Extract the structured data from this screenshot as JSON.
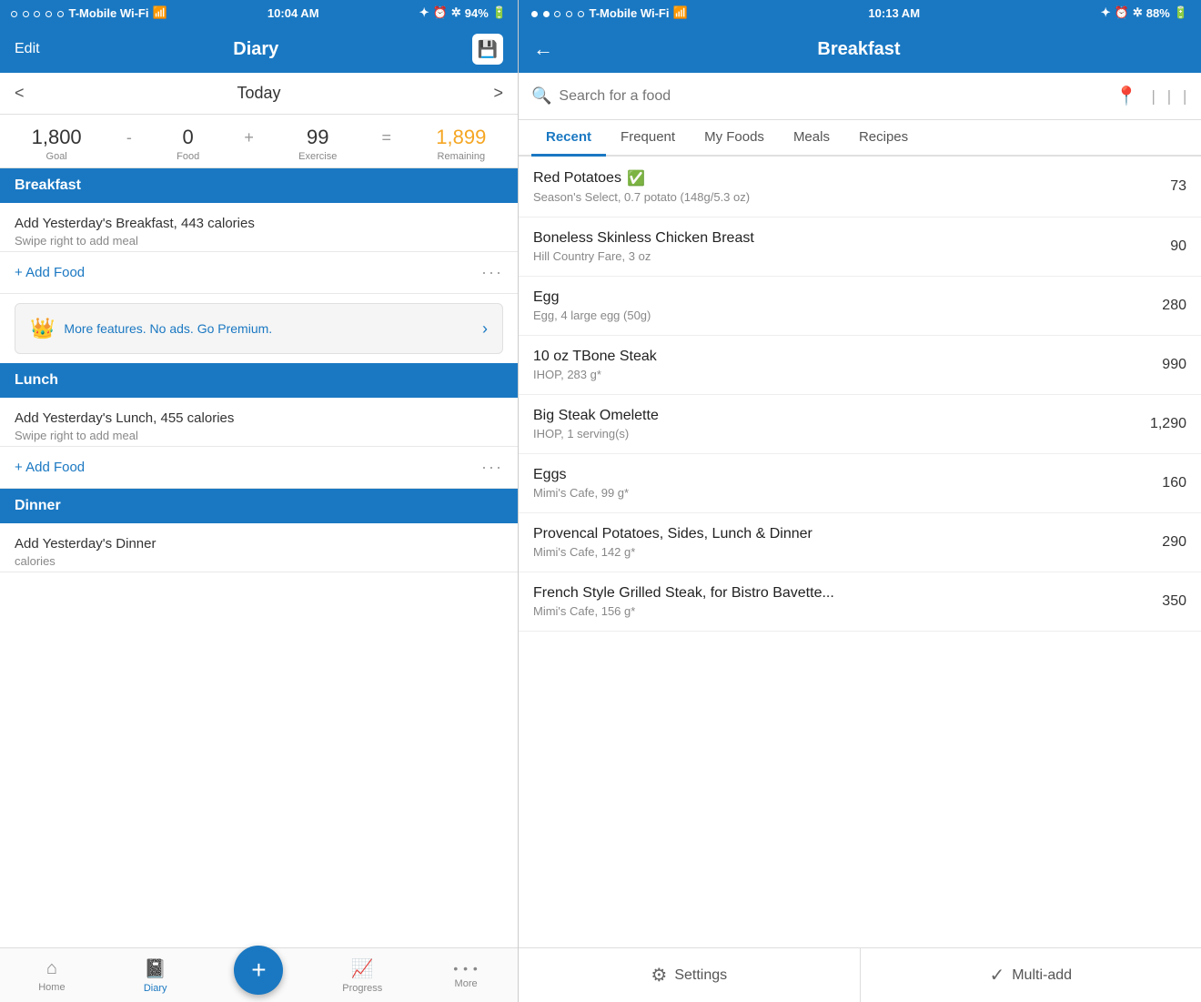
{
  "left": {
    "statusBar": {
      "carrier": "T-Mobile Wi-Fi",
      "time": "10:04 AM",
      "battery": "94%"
    },
    "header": {
      "editLabel": "Edit",
      "title": "Diary",
      "saveIcon": "💾"
    },
    "dateNav": {
      "prev": "<",
      "date": "Today",
      "next": ">"
    },
    "calories": {
      "goal": "1,800",
      "goalLabel": "Goal",
      "op1": "-",
      "food": "0",
      "foodLabel": "Food",
      "op2": "+",
      "exercise": "99",
      "exerciseLabel": "Exercise",
      "op3": "=",
      "remaining": "1,899",
      "remainingLabel": "Remaining"
    },
    "breakfast": {
      "title": "Breakfast",
      "suggestion": "Add Yesterday's Breakfast, 443 calories",
      "suggestionSub": "Swipe right to add meal",
      "addFood": "+ Add Food"
    },
    "premium": {
      "icon": "👑",
      "text": "More features. No ads. Go Premium.",
      "arrow": "›"
    },
    "lunch": {
      "title": "Lunch",
      "suggestion": "Add Yesterday's Lunch, 455 calories",
      "suggestionSub": "Swipe right to add meal",
      "addFood": "+ Add Food"
    },
    "dinner": {
      "title": "Dinner",
      "suggestion": "Add Yesterday's Dinner",
      "suggestionSub": "calories"
    },
    "tabs": [
      {
        "id": "home",
        "icon": "⌂",
        "label": "Home"
      },
      {
        "id": "diary",
        "icon": "📓",
        "label": "Diary",
        "active": true
      },
      {
        "id": "add",
        "icon": "+",
        "label": ""
      },
      {
        "id": "progress",
        "icon": "📈",
        "label": "Progress"
      },
      {
        "id": "more",
        "icon": "•••",
        "label": "More"
      }
    ]
  },
  "right": {
    "statusBar": {
      "carrier": "T-Mobile Wi-Fi",
      "time": "10:13 AM",
      "battery": "88%"
    },
    "header": {
      "backLabel": "←",
      "title": "Breakfast"
    },
    "search": {
      "placeholder": "Search for a food",
      "locationIcon": "📍",
      "barcodeIcon": "|||"
    },
    "tabs": [
      {
        "id": "recent",
        "label": "Recent",
        "active": true
      },
      {
        "id": "frequent",
        "label": "Frequent"
      },
      {
        "id": "myfoods",
        "label": "My Foods"
      },
      {
        "id": "meals",
        "label": "Meals"
      },
      {
        "id": "recipes",
        "label": "Recipes"
      }
    ],
    "foods": [
      {
        "name": "Red Potatoes",
        "verified": true,
        "detail": "Season's Select, 0.7 potato (148g/5.3 oz)",
        "calories": "73"
      },
      {
        "name": "Boneless Skinless Chicken Breast",
        "verified": false,
        "detail": "Hill Country Fare, 3 oz",
        "calories": "90"
      },
      {
        "name": "Egg",
        "verified": false,
        "detail": "Egg, 4 large egg (50g)",
        "calories": "280"
      },
      {
        "name": "10 oz TBone Steak",
        "verified": false,
        "detail": "IHOP, 283 g*",
        "calories": "990"
      },
      {
        "name": "Big Steak Omelette",
        "verified": false,
        "detail": "IHOP, 1 serving(s)",
        "calories": "1,290"
      },
      {
        "name": "Eggs",
        "verified": false,
        "detail": "Mimi's Cafe, 99 g*",
        "calories": "160"
      },
      {
        "name": "Provencal Potatoes, Sides, Lunch & Dinner",
        "verified": false,
        "detail": "Mimi's Cafe, 142 g*",
        "calories": "290"
      },
      {
        "name": "French Style Grilled Steak, for Bistro Bavette...",
        "verified": false,
        "detail": "Mimi's Cafe, 156 g*",
        "calories": "350"
      }
    ],
    "actions": [
      {
        "id": "settings",
        "icon": "⚙",
        "label": "Settings"
      },
      {
        "id": "multiadd",
        "icon": "✓",
        "label": "Multi-add"
      }
    ]
  }
}
